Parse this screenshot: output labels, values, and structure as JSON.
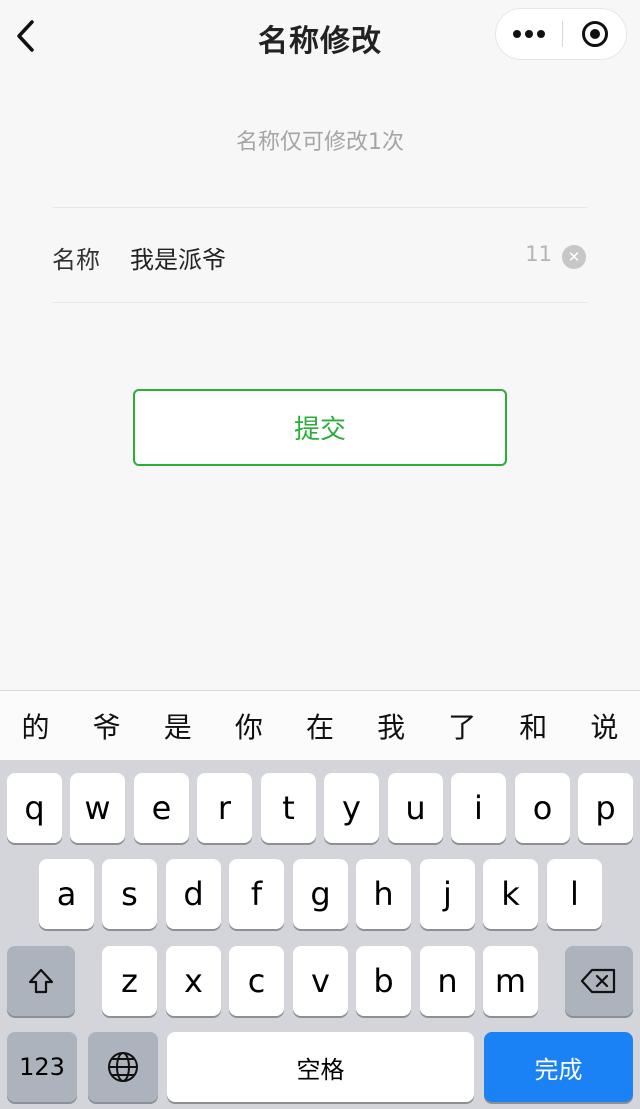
{
  "nav": {
    "title": "名称修改"
  },
  "notice": "名称仅可修改1次",
  "field": {
    "label": "名称",
    "value": "我是派爷",
    "count": "11"
  },
  "submit_label": "提交",
  "candidates": [
    "的",
    "爷",
    "是",
    "你",
    "在",
    "我",
    "了",
    "和",
    "说"
  ],
  "keyboard": {
    "row1": [
      "q",
      "w",
      "e",
      "r",
      "t",
      "y",
      "u",
      "i",
      "o",
      "p"
    ],
    "row2": [
      "a",
      "s",
      "d",
      "f",
      "g",
      "h",
      "j",
      "k",
      "l"
    ],
    "row3": [
      "z",
      "x",
      "c",
      "v",
      "b",
      "n",
      "m"
    ],
    "num_label": "123",
    "space_label": "空格",
    "done_label": "完成"
  },
  "colors": {
    "accent": "#2aae3a",
    "done_key": "#1b82f5"
  }
}
